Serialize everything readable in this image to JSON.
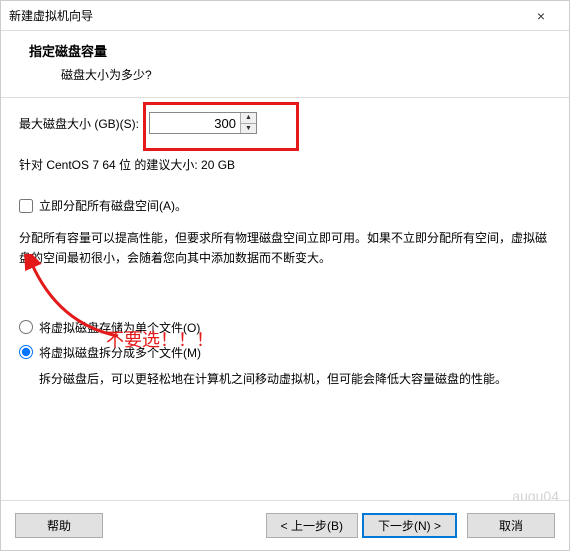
{
  "window": {
    "title": "新建虚拟机向导",
    "close_icon": "×"
  },
  "header": {
    "title": "指定磁盘容量",
    "subtitle": "磁盘大小为多少?"
  },
  "disk": {
    "size_label": "最大磁盘大小 (GB)(S):",
    "size_value": "300",
    "recommended": "针对 CentOS 7 64 位 的建议大小: 20 GB"
  },
  "allocate": {
    "checkbox_label": "立即分配所有磁盘空间(A)。",
    "description": "分配所有容量可以提高性能，但要求所有物理磁盘空间立即可用。如果不立即分配所有空间，虚拟磁盘的空间最初很小，会随着您向其中添加数据而不断变大。"
  },
  "store": {
    "single_label": "将虚拟磁盘存储为单个文件(O)",
    "split_label": "将虚拟磁盘拆分成多个文件(M)",
    "split_desc": "拆分磁盘后，可以更轻松地在计算机之间移动虚拟机，但可能会降低大容量磁盘的性能。"
  },
  "annotation": {
    "text": "不要选！！！",
    "arrow_color": "#e41a1a"
  },
  "footer": {
    "help": "帮助",
    "back": "< 上一步(B)",
    "next": "下一步(N) >",
    "cancel": "取消"
  },
  "watermark": "augu04"
}
